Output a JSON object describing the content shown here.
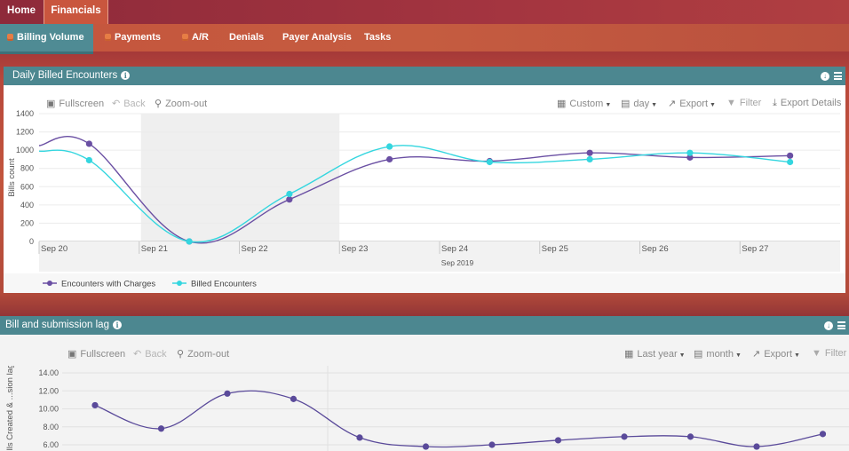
{
  "top_tabs": [
    {
      "label": "Home"
    },
    {
      "label": "Financials"
    }
  ],
  "sub_tabs": [
    {
      "label": "Billing Volume"
    },
    {
      "label": "Payments"
    },
    {
      "label": "A/R"
    },
    {
      "label": "Denials"
    },
    {
      "label": "Payer Analysis"
    },
    {
      "label": "Tasks"
    }
  ],
  "panel1": {
    "title": "Daily Billed Encounters",
    "toolbar": {
      "fullscreen": "Fullscreen",
      "back": "Back",
      "zoomout": "Zoom-out",
      "range": "Custom",
      "interval": "day",
      "export": "Export",
      "filter": "Filter",
      "export_details": "Export Details"
    }
  },
  "panel2": {
    "title": "Bill and submission lag",
    "toolbar": {
      "fullscreen": "Fullscreen",
      "back": "Back",
      "zoomout": "Zoom-out",
      "range": "Last year",
      "interval": "month",
      "export": "Export",
      "filter": "Filter"
    }
  },
  "chart_data": [
    {
      "type": "line",
      "ylabel": "Bills count",
      "xlabel": "Sep 2019",
      "ylim": [
        0,
        1400
      ],
      "yticks": [
        0,
        200,
        400,
        600,
        800,
        1000,
        1200,
        1400
      ],
      "xticks": [
        "Sep 20",
        "Sep 21",
        "Sep 22",
        "Sep 23",
        "Sep 24",
        "Sep 25",
        "Sep 26",
        "Sep 27"
      ],
      "highlighted_range": [
        "Sep 21",
        "Sep 23"
      ],
      "grid": true,
      "legend": "bottom-left",
      "series": [
        {
          "name": "Encounters with Charges",
          "color": "#6a4fa3",
          "x": [
            0.5,
            1.5,
            2.5,
            3.5,
            4.5,
            5.5,
            6.5,
            7.5
          ],
          "values": [
            1070,
            0,
            460,
            900,
            880,
            970,
            920,
            940
          ]
        },
        {
          "name": "Billed Encounters",
          "color": "#34d6df",
          "x": [
            0.5,
            1.5,
            2.5,
            3.5,
            4.5,
            5.5,
            6.5,
            7.5
          ],
          "values": [
            890,
            0,
            520,
            1040,
            870,
            900,
            970,
            870
          ]
        }
      ]
    },
    {
      "type": "line",
      "ylabel": "... bills Created & ...sion lag (in days)",
      "ylim": [
        6,
        14
      ],
      "yticks": [
        "6.00",
        "8.00",
        "10.00",
        "12.00",
        "14.00"
      ],
      "grid": true,
      "series": [
        {
          "color": "#5a4a9a",
          "values": [
            10.4,
            7.8,
            11.7,
            11.1,
            6.8,
            5.8,
            6.0,
            6.5,
            6.9,
            6.9,
            5.8,
            7.2
          ]
        }
      ]
    }
  ]
}
